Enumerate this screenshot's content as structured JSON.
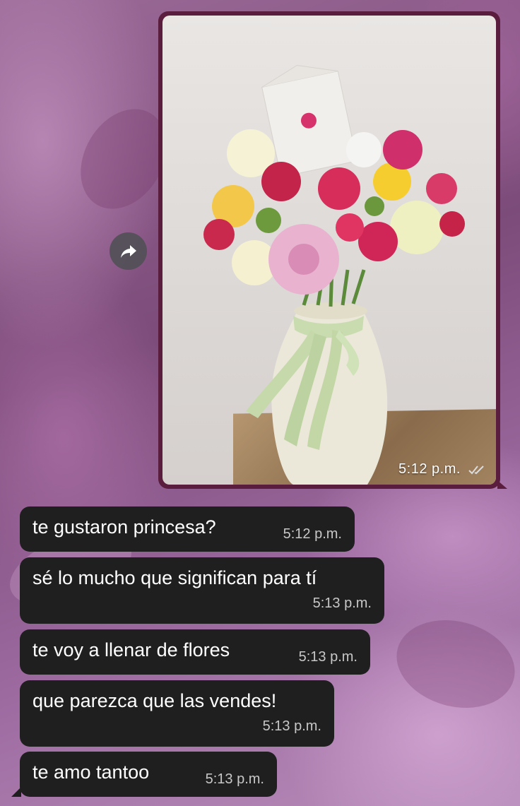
{
  "image_message": {
    "time": "5:12 p.m.",
    "status_icon": "double-check-icon",
    "content": "photo of a bouquet of flowers in a white vase"
  },
  "forward_icon": "forward-arrow-icon",
  "messages": [
    {
      "text": "te gustaron princesa?",
      "time": "5:12 p.m."
    },
    {
      "text": "sé lo mucho que significan para tí",
      "time": "5:13 p.m."
    },
    {
      "text": "te voy a llenar de flores",
      "time": "5:13 p.m."
    },
    {
      "text": "que parezca que las vendes!",
      "time": "5:13 p.m."
    },
    {
      "text": "te amo tantoo",
      "time": "5:13 p.m."
    }
  ],
  "colors": {
    "incoming_bubble": "#1f1f1f",
    "image_frame": "#5b1d3d",
    "wallpaper": "#8a5a86"
  }
}
